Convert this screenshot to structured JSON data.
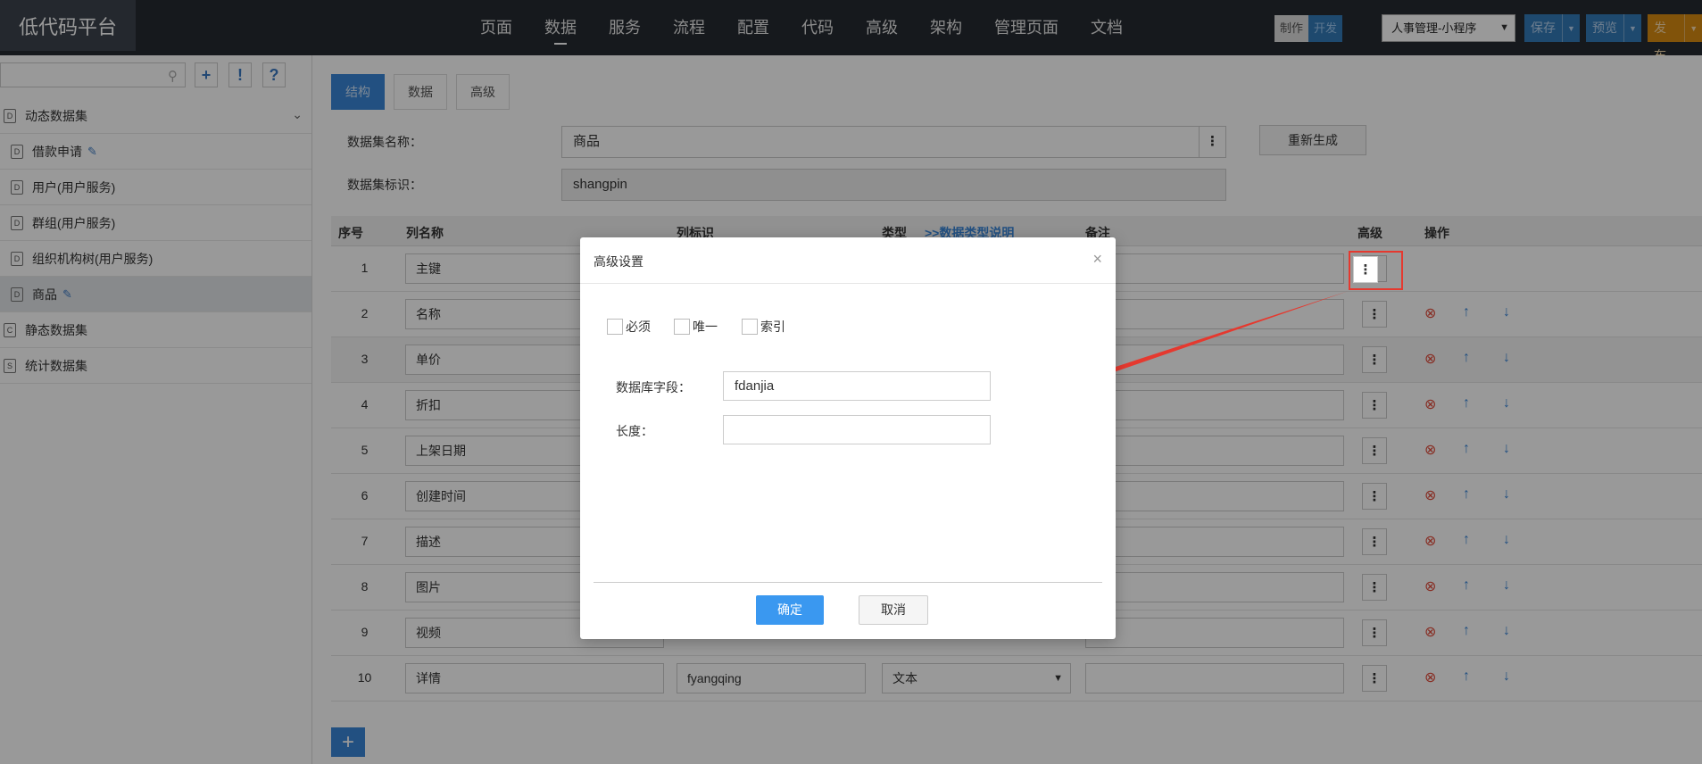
{
  "header": {
    "logo": "低代码平台",
    "nav": [
      "页面",
      "数据",
      "服务",
      "流程",
      "配置",
      "代码",
      "高级",
      "架构",
      "管理页面",
      "文档"
    ],
    "mode": {
      "a": "制作",
      "b": "开发"
    },
    "app_select": "人事管理-小程序",
    "save": "保存",
    "preview": "预览",
    "publish": "发布"
  },
  "sidebar": {
    "search_placeholder": "",
    "tools": [
      "+",
      "!",
      "?"
    ],
    "groups": [
      {
        "label": "动态数据集",
        "icon": "D"
      },
      {
        "label": "静态数据集",
        "icon": "C"
      },
      {
        "label": "统计数据集",
        "icon": "S"
      }
    ],
    "items": [
      {
        "label": "借款申请",
        "icon": "D"
      },
      {
        "label": "用户(用户服务)",
        "icon": "D"
      },
      {
        "label": "群组(用户服务)",
        "icon": "D"
      },
      {
        "label": "组织机构树(用户服务)",
        "icon": "D"
      },
      {
        "label": "商品",
        "icon": "D"
      }
    ]
  },
  "tabs": [
    "结构",
    "数据",
    "高级"
  ],
  "form": {
    "name_label": "数据集名称：",
    "name_value": "商品",
    "id_label": "数据集标识：",
    "id_value": "shangpin",
    "regen": "重新生成"
  },
  "table": {
    "headers": {
      "idx": "序号",
      "name": "列名称",
      "ident": "列标识",
      "type": "类型",
      "type_link": ">>数据类型说明",
      "remark": "备注",
      "adv": "高级",
      "op": "操作"
    },
    "rows": [
      {
        "idx": "1",
        "name": "主键"
      },
      {
        "idx": "2",
        "name": "名称"
      },
      {
        "idx": "3",
        "name": "单价"
      },
      {
        "idx": "4",
        "name": "折扣"
      },
      {
        "idx": "5",
        "name": "上架日期"
      },
      {
        "idx": "6",
        "name": "创建时间"
      },
      {
        "idx": "7",
        "name": "描述"
      },
      {
        "idx": "8",
        "name": "图片"
      },
      {
        "idx": "9",
        "name": "视频"
      },
      {
        "idx": "10",
        "name": "详情",
        "ident": "fyangqing",
        "type": "文本"
      }
    ]
  },
  "modal": {
    "title": "高级设置",
    "close": "×",
    "checks": [
      "必须",
      "唯一",
      "索引"
    ],
    "db_field_label": "数据库字段：",
    "db_field_value": "fdanjia",
    "length_label": "长度：",
    "length_value": "",
    "ok": "确定",
    "cancel": "取消"
  },
  "colors": {
    "accent": "#3a86d8",
    "danger": "#e24b3b",
    "annotation": "#e5392f"
  }
}
